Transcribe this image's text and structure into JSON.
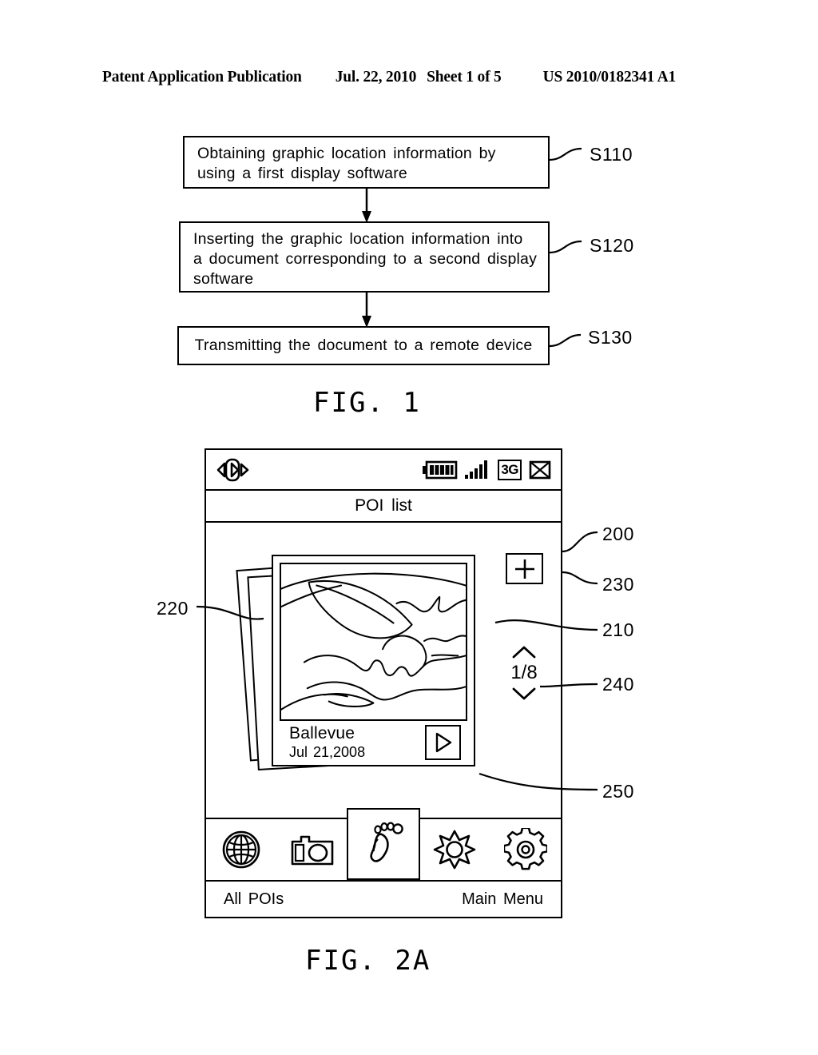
{
  "header": {
    "publication": "Patent Application Publication",
    "date": "Jul. 22, 2010",
    "sheet": "Sheet 1 of 5",
    "patent_number": "US 2010/0182341 A1"
  },
  "figure1": {
    "caption": "FIG. 1",
    "steps": [
      {
        "id": "S110",
        "text": "Obtaining graphic location information by using a first display software"
      },
      {
        "id": "S120",
        "text": "Inserting the graphic location information into a document corresponding to a second display software"
      },
      {
        "id": "S130",
        "text": "Transmitting the document to a remote device"
      }
    ],
    "ref_labels": [
      "S110",
      "S120",
      "S130"
    ]
  },
  "figure2a": {
    "caption": "FIG. 2A",
    "device": {
      "status_bar": {
        "sound_icon": "speaker-icon",
        "battery_icon": "battery-icon",
        "battery_bars": 5,
        "signal_icon": "signal-bars-icon",
        "signal_bars": 5,
        "network": "3G",
        "message_icon": "envelope-icon"
      },
      "title": "POI list",
      "content": {
        "photo_card": {
          "title": "Ballevue",
          "date": "Jul 21,2008",
          "artwork": "landscape-line-art",
          "play_icon": "play-icon"
        },
        "add_button_icon": "plus-icon",
        "pager": {
          "up_icon": "chevron-up-icon",
          "count": "1/8",
          "down_icon": "chevron-down-icon"
        }
      },
      "toolbar": [
        {
          "name": "globe-icon",
          "label": "globe",
          "selected": false
        },
        {
          "name": "camera-icon",
          "label": "camera",
          "selected": false
        },
        {
          "name": "footprint-icon",
          "label": "footprint",
          "selected": true
        },
        {
          "name": "sun-icon",
          "label": "sun",
          "selected": false
        },
        {
          "name": "gear-icon",
          "label": "gear",
          "selected": false
        }
      ],
      "softkeys": {
        "left": "All POIs",
        "right": "Main Menu"
      }
    },
    "ref_labels": {
      "r200": "200",
      "r210": "210",
      "r220": "220",
      "r230": "230",
      "r240": "240",
      "r250": "250"
    }
  }
}
